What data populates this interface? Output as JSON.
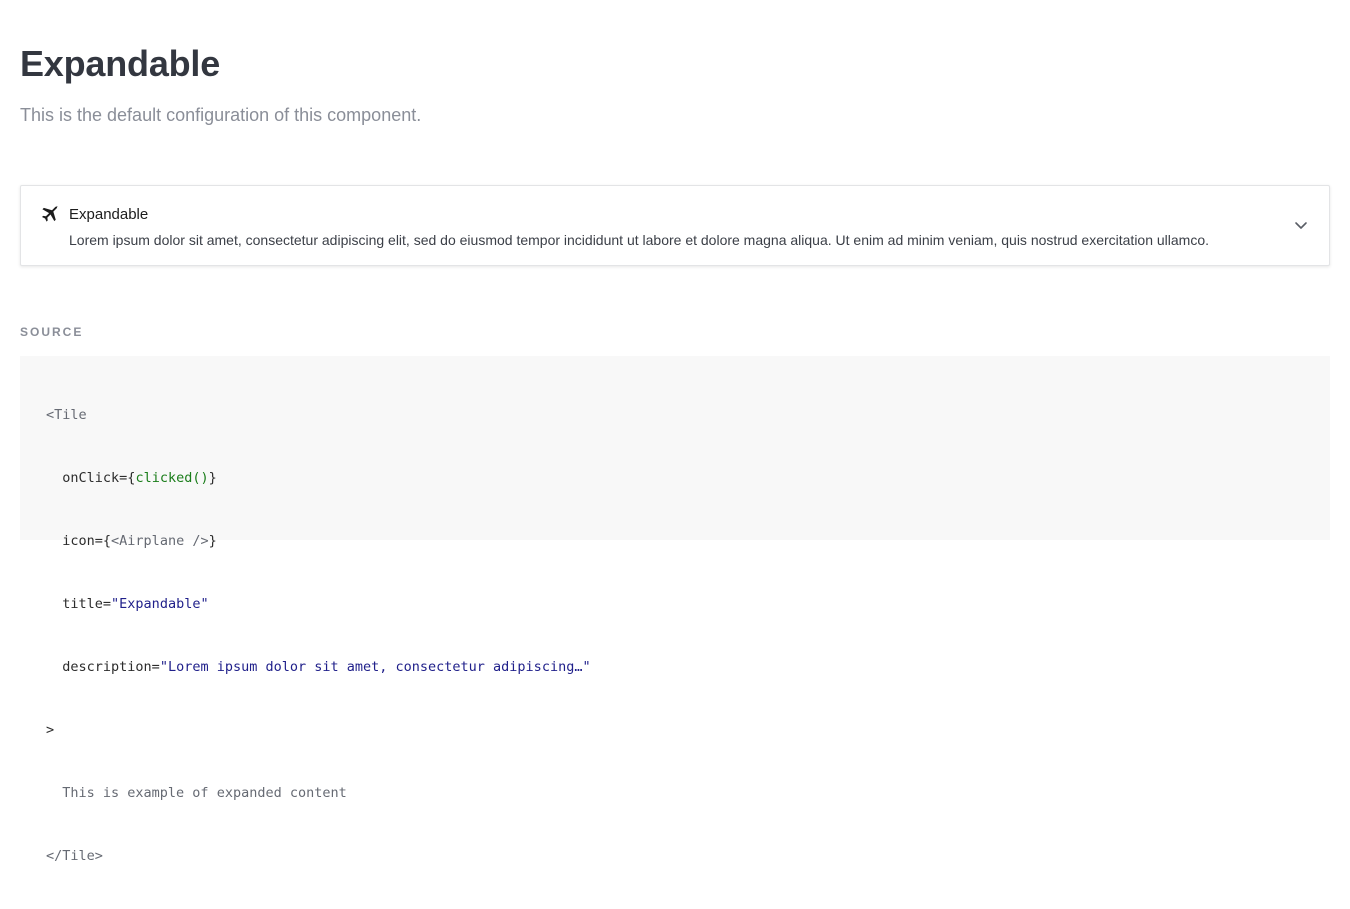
{
  "header": {
    "title": "Expandable",
    "subtitle": "This is the default configuration of this component."
  },
  "tile": {
    "icon": "airplane-icon",
    "title": "Expandable",
    "description": "Lorem ipsum dolor sit amet, consectetur adipiscing elit, sed do eiusmod tempor incididunt ut labore et dolore magna aliqua. Ut enim ad minim veniam, quis nostrud exercitation ullamco.",
    "toggle_icon": "chevron-down-icon"
  },
  "source": {
    "label": "SOURCE",
    "code": {
      "open_tag": "<Tile",
      "onclick_attr": "onClick=",
      "onclick_open": "{",
      "onclick_value": "clicked()",
      "onclick_close": "}",
      "icon_attr": "icon=",
      "icon_open": "{",
      "icon_value": "<Airplane />",
      "icon_close": "}",
      "title_attr": "title=",
      "title_value": "\"Expandable\"",
      "desc_attr": "description=",
      "desc_value": "\"Lorem ipsum dolor sit amet, consectetur adipiscing…\"",
      "gt": ">",
      "child_text": "This is example of expanded content",
      "close_tag": "</Tile>"
    }
  },
  "colors": {
    "heading": "#333740",
    "muted": "#8a8e98",
    "code_bg": "#f8f8f8",
    "code_string": "#1f1f8a",
    "code_function": "#1a7d1a"
  }
}
